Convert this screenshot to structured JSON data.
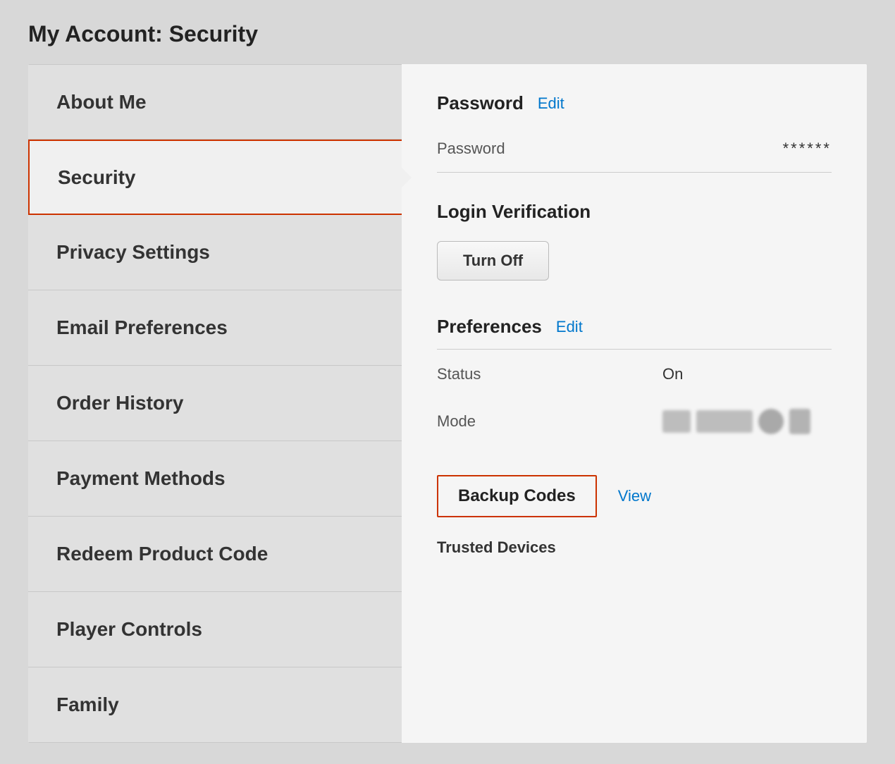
{
  "page": {
    "title": "My Account: Security"
  },
  "sidebar": {
    "items": [
      {
        "id": "about-me",
        "label": "About Me",
        "active": false
      },
      {
        "id": "security",
        "label": "Security",
        "active": true
      },
      {
        "id": "privacy-settings",
        "label": "Privacy Settings",
        "active": false
      },
      {
        "id": "email-preferences",
        "label": "Email Preferences",
        "active": false
      },
      {
        "id": "order-history",
        "label": "Order History",
        "active": false
      },
      {
        "id": "payment-methods",
        "label": "Payment Methods",
        "active": false
      },
      {
        "id": "redeem-product-code",
        "label": "Redeem Product Code",
        "active": false
      },
      {
        "id": "player-controls",
        "label": "Player Controls",
        "active": false
      },
      {
        "id": "family",
        "label": "Family",
        "active": false
      }
    ]
  },
  "main": {
    "password_section": {
      "title": "Password",
      "edit_label": "Edit",
      "field_label": "Password",
      "field_value": "******"
    },
    "login_verification": {
      "title": "Login Verification",
      "turn_off_label": "Turn Off"
    },
    "preferences": {
      "title": "Preferences",
      "edit_label": "Edit",
      "status_label": "Status",
      "status_value": "On",
      "mode_label": "Mode"
    },
    "backup_codes": {
      "label": "Backup Codes",
      "view_label": "View"
    },
    "trusted_devices": {
      "title": "Trusted Devices"
    }
  }
}
